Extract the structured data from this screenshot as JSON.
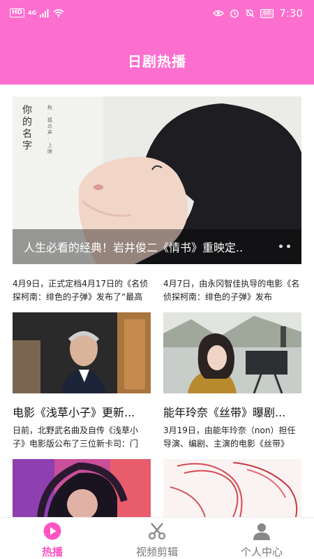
{
  "status_bar": {
    "network_badge": "HD",
    "signal_type": "4G",
    "battery": "68",
    "time": "7:30"
  },
  "header": {
    "title": "日剧热播"
  },
  "banner": {
    "caption": "人生必看的经典！岩井俊二《情书》重映定..",
    "poster_text": "你的名字",
    "poster_subtext": "秋 · 狐の声 · 上映"
  },
  "news": [
    {
      "excerpt": "4月9日，正式定档4月17日的《名侦探柯南：绯色的子弹》发布了“最高"
    },
    {
      "excerpt": "4月7日，由永冈智佳执导的电影《名侦探柯南：绯色的子弹》发布"
    }
  ],
  "cards": [
    {
      "title": "电影《浅草小子》更新...",
      "excerpt": "日前，北野武名曲及自传《浅草小子》电影版公布了三位新卡司：门"
    },
    {
      "title": "能年玲奈《丝带》曝剧...",
      "excerpt": "3月19日，由能年玲奈（non）担任导演、编剧、主演的电影《丝带》"
    }
  ],
  "tabs": [
    {
      "label": "热播",
      "icon": "play-circle-icon",
      "active": true
    },
    {
      "label": "视频剪辑",
      "icon": "scissors-icon",
      "active": false
    },
    {
      "label": "个人中心",
      "icon": "person-icon",
      "active": false
    }
  ],
  "colors": {
    "accent": "#fd6fce",
    "tab_active": "#fd55c2"
  }
}
